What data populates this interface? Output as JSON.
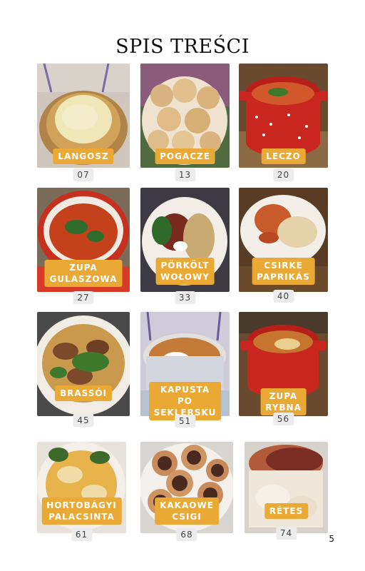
{
  "page": {
    "title": "SPIS TREŚCI",
    "page_number": "5"
  },
  "recipes": [
    {
      "name": "LANGOSZ",
      "page": "07"
    },
    {
      "name": "POGACZE",
      "page": "13"
    },
    {
      "name": "LECZO",
      "page": "20"
    },
    {
      "name": "ZUPA\nGULASZOWA",
      "page": "27"
    },
    {
      "name": "PÖRKÖLT\nWOŁOWY",
      "page": "33"
    },
    {
      "name": "CSIRKE\nPAPRIKÁS",
      "page": "40"
    },
    {
      "name": "BRASSÓI",
      "page": "45"
    },
    {
      "name": "KAPUSTA PO\nSEKLERSKU",
      "page": "51"
    },
    {
      "name": "ZUPA RYBNA",
      "page": "56"
    },
    {
      "name": "HORTOBÁGYI\nPALACSINTA",
      "page": "61"
    },
    {
      "name": "KAKAOWE\nCSIGI",
      "page": "68"
    },
    {
      "name": "RÉTES",
      "page": "74"
    }
  ]
}
